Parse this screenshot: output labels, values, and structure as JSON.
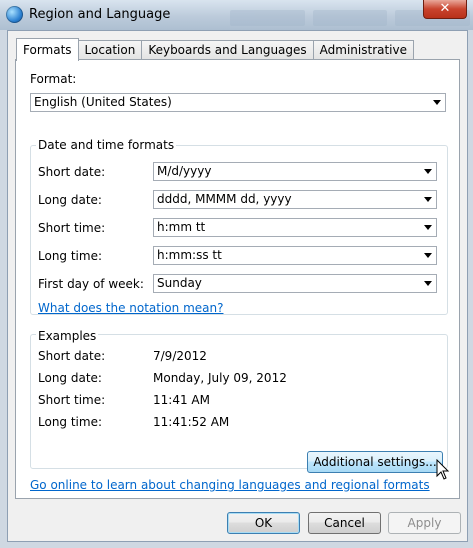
{
  "window": {
    "title": "Region and Language",
    "close_glyph": "✕"
  },
  "tabs": [
    {
      "label": "Formats",
      "active": true
    },
    {
      "label": "Location"
    },
    {
      "label": "Keyboards and Languages"
    },
    {
      "label": "Administrative"
    }
  ],
  "format": {
    "label": "Format:",
    "value": "English (United States)"
  },
  "date_time": {
    "title": "Date and time formats",
    "short_date": {
      "label": "Short date:",
      "value": "M/d/yyyy"
    },
    "long_date": {
      "label": "Long date:",
      "value": "dddd, MMMM dd, yyyy"
    },
    "short_time": {
      "label": "Short time:",
      "value": "h:mm tt"
    },
    "long_time": {
      "label": "Long time:",
      "value": "h:mm:ss tt"
    },
    "first_day": {
      "label": "First day of week:",
      "value": "Sunday"
    },
    "notation_link": "What does the notation mean?"
  },
  "examples": {
    "title": "Examples",
    "short_date": {
      "label": "Short date:",
      "value": "7/9/2012"
    },
    "long_date": {
      "label": "Long date:",
      "value": "Monday, July 09, 2012"
    },
    "short_time": {
      "label": "Short time:",
      "value": "11:41 AM"
    },
    "long_time": {
      "label": "Long time:",
      "value": "11:41:52 AM"
    }
  },
  "additional_settings": "Additional settings...",
  "online_link": "Go online to learn about changing languages and regional formats",
  "buttons": {
    "ok": "OK",
    "cancel": "Cancel",
    "apply": "Apply"
  },
  "colors": {
    "link": "#0066cc",
    "close": "#c9432d"
  },
  "icons": {
    "app": "globe-icon",
    "close": "close-icon",
    "dropdown": "chevron-down-icon",
    "cursor": "mouse-pointer-icon"
  }
}
